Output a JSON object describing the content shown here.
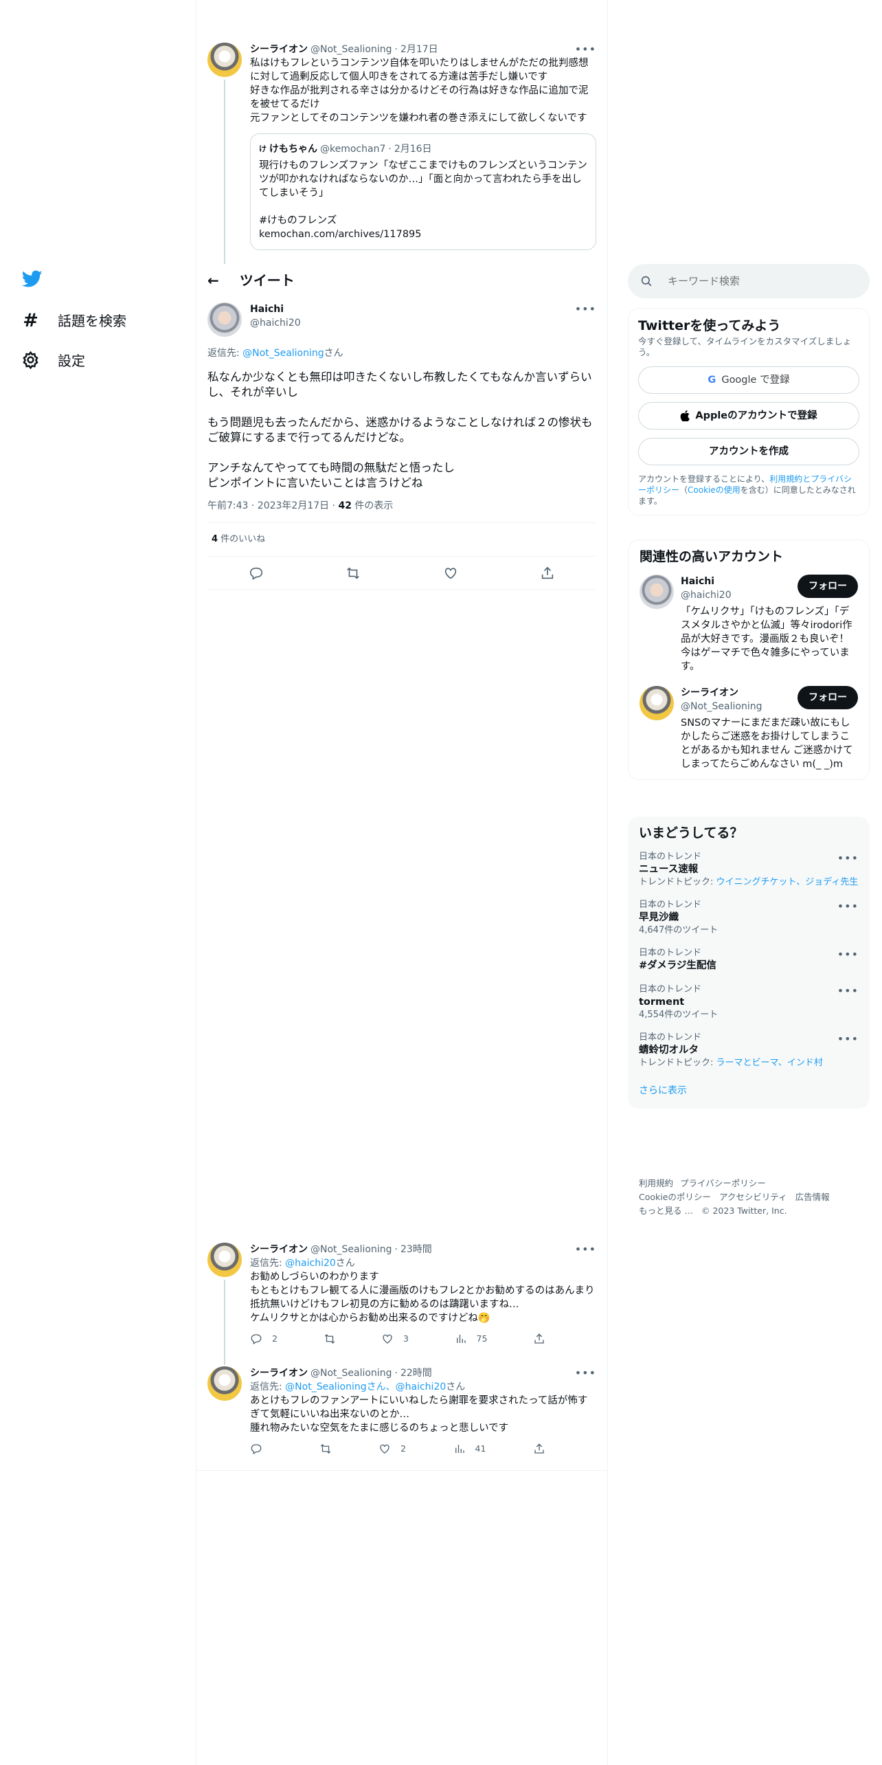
{
  "nav": {
    "settings_label": "設定",
    "explore_label": "話題を検索"
  },
  "header": {
    "title": "ツイート"
  },
  "top_tweet": {
    "name": "シーライオン",
    "handle": "@Not_Sealioning",
    "time": "2月17日",
    "text": "私はけもフレというコンテンツ自体を叩いたりはしませんがただの批判感想に対して過剰反応して個人叩きをされてる方達は苦手だし嫌いです\n好きな作品が批判される辛さは分かるけどその行為は好きな作品に追加で泥を被せてるだけ\n元ファンとしてそのコンテンツを嫌われ者の巻き添えにして欲しくないです",
    "quote": {
      "name": "けもちゃん",
      "handle": "@kemochan7",
      "time": "2月16日",
      "text": "現行けものフレンズファン「なぜここまでけものフレンズというコンテンツが叩かれなければならないのか…」「面と向かって言われたら手を出してしまいそう」\n\n#けものフレンズ\nkemochan.com/archives/117895"
    }
  },
  "main_tweet": {
    "name": "Haichi",
    "handle": "@haichi20",
    "reply_to_prefix": "返信先: ",
    "reply_to_handle": "@Not_Sealioning",
    "reply_to_suffix": "さん",
    "text": "私なんか少なくとも無印は叩きたくないし布教したくてもなんか言いずらいし、それが辛いし\n\nもう問題児も去ったんだから、迷惑かけるようなことしなければ２の惨状もご破算にするまで行ってるんだけどな。\n\nアンチなんてやってても時間の無駄だと悟ったし\nピンポイントに言いたいことは言うけどね",
    "time": "午前7:43 · 2023年2月17日 · ",
    "views_count": "42",
    "views_label": " 件の表示",
    "likes_count": "4",
    "likes_label": " 件のいいね"
  },
  "replies": [
    {
      "name": "シーライオン",
      "handle": "@Not_Sealioning",
      "time": "23時間",
      "reply_prefix": "返信先: ",
      "reply_handles": "@haichi20",
      "reply_suffix": "さん",
      "text": "お勧めしづらいのわかります\nもともとけもフレ観てる人に漫画版のけもフレ2とかお勧めするのはあんまり抵抗無いけどけもフレ初見の方に勧めるのは躊躇いますね…\nケムリクサとかは心からお勧め出来るのですけどね🤭",
      "replies_count": "2",
      "likes_count": "3",
      "views_count": "75"
    },
    {
      "name": "シーライオン",
      "handle": "@Not_Sealioning",
      "time": "22時間",
      "reply_prefix": "返信先: ",
      "reply_handles": "@Not_Sealioningさん、@haichi20",
      "reply_suffix": "さん",
      "text": "あとけもフレのファンアートにいいねしたら謝罪を要求されたって話が怖すぎて気軽にいいね出来ないのとか…\n腫れ物みたいな空気をたまに感じるのちょっと悲しいです",
      "replies_count": "",
      "likes_count": "2",
      "views_count": "41"
    }
  ],
  "search": {
    "placeholder": "キーワード検索"
  },
  "signup": {
    "title": "Twitterを使ってみよう",
    "subtitle": "今すぐ登録して、タイムラインをカスタマイズしましょう。",
    "google": "Google で登録",
    "apple": "Appleのアカウントで登録",
    "create": "アカウントを作成",
    "terms_prefix": "アカウントを登録することにより、",
    "terms_link": "利用規約とプライバシーポリシー",
    "terms_mid": "（",
    "cookie_link": "Cookieの使用",
    "terms_suffix": "を含む）に同意したとみなされます。"
  },
  "related": {
    "title": "関連性の高いアカウント",
    "follow_label": "フォロー",
    "accounts": [
      {
        "name": "Haichi",
        "handle": "@haichi20",
        "bio": "「ケムリクサ」「けものフレンズ」「デスメタルさやかと仏滅」等々irodori作品が大好きです。漫画版２も良いぞ！ 今はゲーマチで色々雑多にやっています。"
      },
      {
        "name": "シーライオン",
        "handle": "@Not_Sealioning",
        "bio": "SNSのマナーにまだまだ疎い故にもしかしたらご迷惑をお掛けしてしまうことがあるかも知れません ご迷惑かけてしまってたらごめんなさい m(_ _)m"
      }
    ]
  },
  "trends": {
    "title": "いまどうしてる？",
    "items": [
      {
        "category": "日本のトレンド",
        "name": "ニュース速報",
        "meta_prefix": "トレンドトピック: ",
        "meta_link": "ウイニングチケット、ジョディ先生",
        "meta": ""
      },
      {
        "category": "日本のトレンド",
        "name": "早見沙織",
        "meta_prefix": "",
        "meta_link": "",
        "meta": "4,647件のツイート"
      },
      {
        "category": "日本のトレンド",
        "name": "#ダメラジ生配信",
        "meta_prefix": "",
        "meta_link": "",
        "meta": ""
      },
      {
        "category": "日本のトレンド",
        "name": "torment",
        "meta_prefix": "",
        "meta_link": "",
        "meta": "4,554件のツイート"
      },
      {
        "category": "日本のトレンド",
        "name": "蜻蛉切オルタ",
        "meta_prefix": "トレンドトピック: ",
        "meta_link": "ラーマとビーマ、インド村",
        "meta": ""
      }
    ],
    "show_more": "さらに表示"
  },
  "footer": {
    "terms": "利用規約",
    "privacy": "プライバシーポリシー",
    "cookie": "Cookieのポリシー",
    "accessibility": "アクセシビリティ",
    "ads": "広告情報",
    "more": "もっと見る …",
    "copyright": "© 2023 Twitter, Inc."
  },
  "colors": {
    "brand": "#1d9bf0",
    "text": "#0f1419",
    "muted": "#536471"
  }
}
